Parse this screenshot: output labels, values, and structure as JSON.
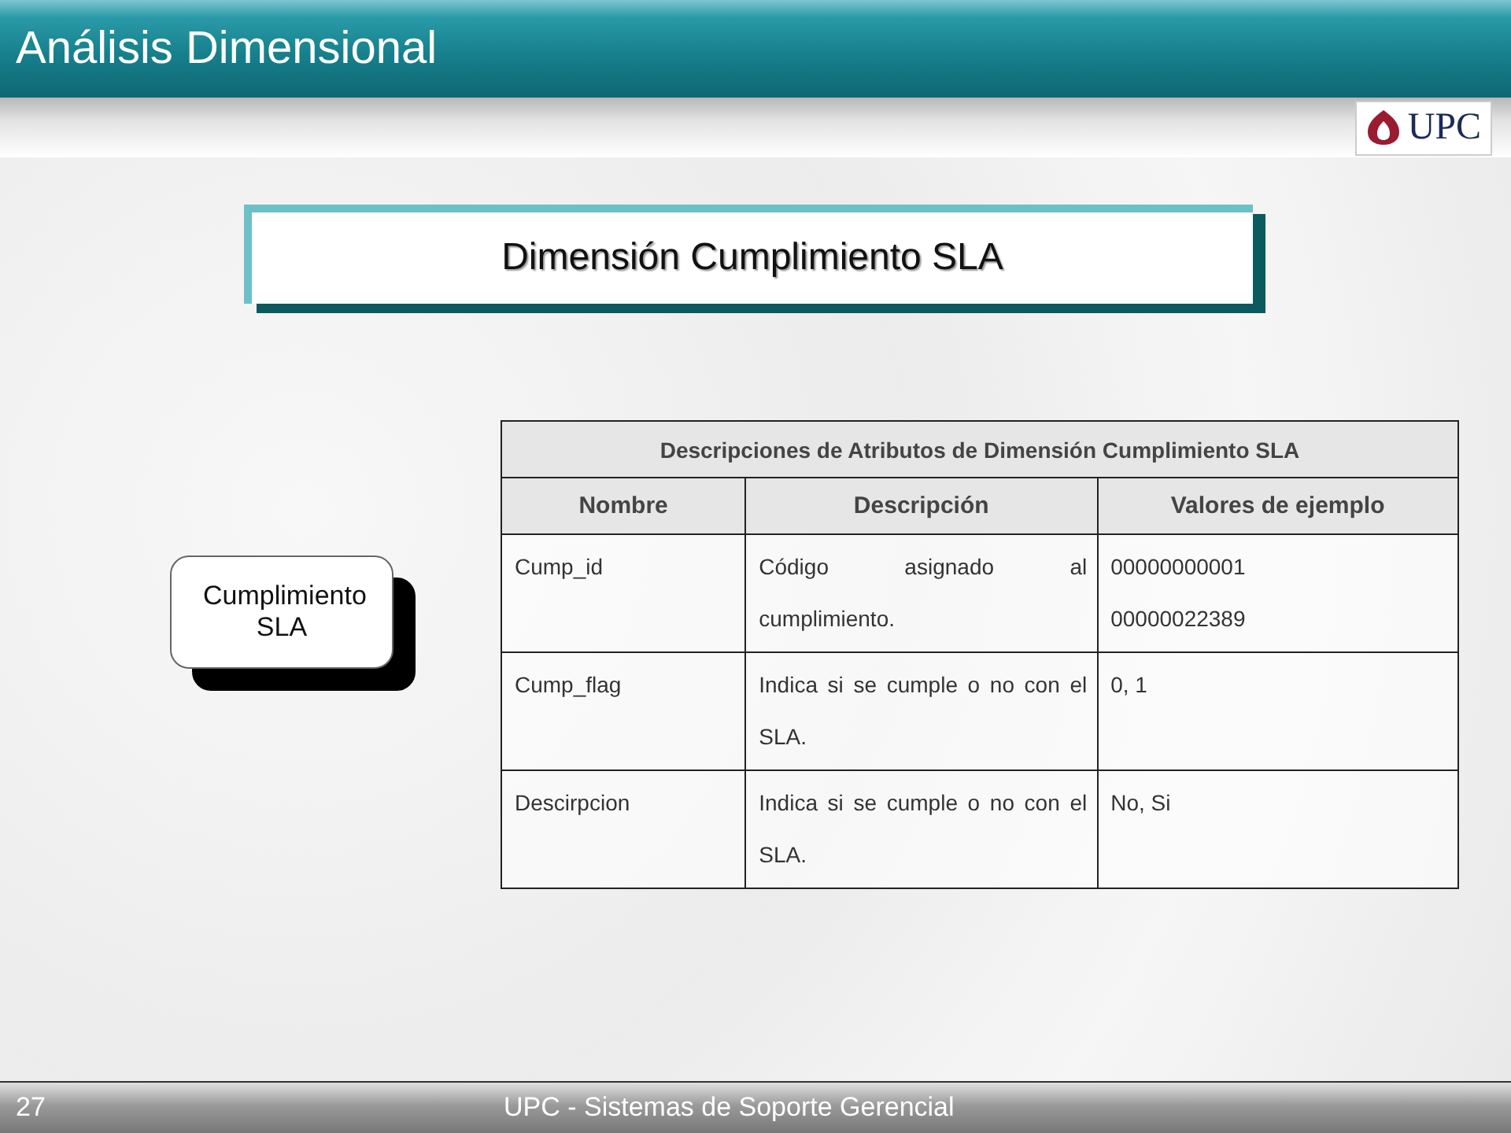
{
  "header": {
    "title": "Análisis Dimensional",
    "logo_text": "UPC"
  },
  "section_title": "Dimensión Cumplimiento SLA",
  "entity": {
    "label": "Cumplimiento SLA"
  },
  "table": {
    "caption": "Descripciones de Atributos de Dimensión Cumplimiento SLA",
    "columns": [
      "Nombre",
      "Descripción",
      "Valores de ejemplo"
    ],
    "rows": [
      {
        "name": "Cump_id",
        "description": "Código asignado al cumplimiento.",
        "examples": [
          "00000000001",
          "00000022389"
        ]
      },
      {
        "name": "Cump_flag",
        "description": "Indica si se cumple o no con el SLA.",
        "examples": [
          "0, 1"
        ]
      },
      {
        "name": "Descirpcion",
        "description": "Indica si se cumple o no con el SLA.",
        "examples": [
          "No, Si"
        ]
      }
    ]
  },
  "footer": {
    "page_number": "27",
    "text": "UPC - Sistemas de Soporte Gerencial"
  }
}
